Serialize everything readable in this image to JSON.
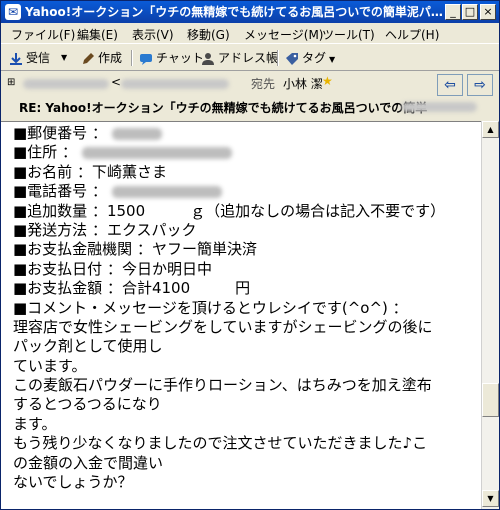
{
  "window": {
    "title": "Yahoo!オークション「ウチの無精嫁でも続けてるお風呂ついでの簡単泥パック素…",
    "min_label": "_",
    "max_label": "□",
    "close_label": "×"
  },
  "menu": {
    "items": [
      "ファイル(F)",
      "編集(E)",
      "表示(V)",
      "移動(G)",
      "メッセージ(M)",
      "ツール(T)",
      "ヘルプ(H)"
    ]
  },
  "toolbar": {
    "receive": "受信",
    "compose": "作成",
    "chat": "チャット",
    "address_book": "アドレス帳",
    "tag": "タグ",
    "dropdown_arrow": "▼"
  },
  "header": {
    "from_bracket": "<",
    "to_label": "宛先",
    "to_name": "小林 潔",
    "subject": "RE: Yahoo!オークション「ウチの無精嫁でも続けてるお風呂ついでの簡単",
    "prev": "⇦",
    "next": "⇨"
  },
  "body": {
    "lines": [
      "■郵便番号 ：",
      "■住所 ：",
      "■お名前 ：下崎薫さま",
      "■電話番号 ：",
      "■追加数量 ：1500　　　ｇ（追加なしの場合は記入不要です）",
      "■発送方法 ：エクスパック",
      "■お支払金融機関 ：ヤフー簡単決済",
      "■お支払日付 ：今日か明日中",
      "■お支払金額 ：合計4100　　　円",
      "■コメント・メッセージを頂けるとウレシイです(^o^) ：",
      "理容店で女性シェービングをしていますがシェービングの後に",
      "パック剤として使用し",
      "ています。",
      "この麦飯石パウダーに手作りローション、はちみつを加え塗布",
      "するとつるつるになり",
      "ます。",
      "もう残り少なくなりましたので注文させていただきました♪こ",
      "の金額の入金で間違い",
      "ないでしょうか？"
    ]
  },
  "colors": {
    "titlebar": "#0b3fa8",
    "chrome": "#ece9d8"
  }
}
